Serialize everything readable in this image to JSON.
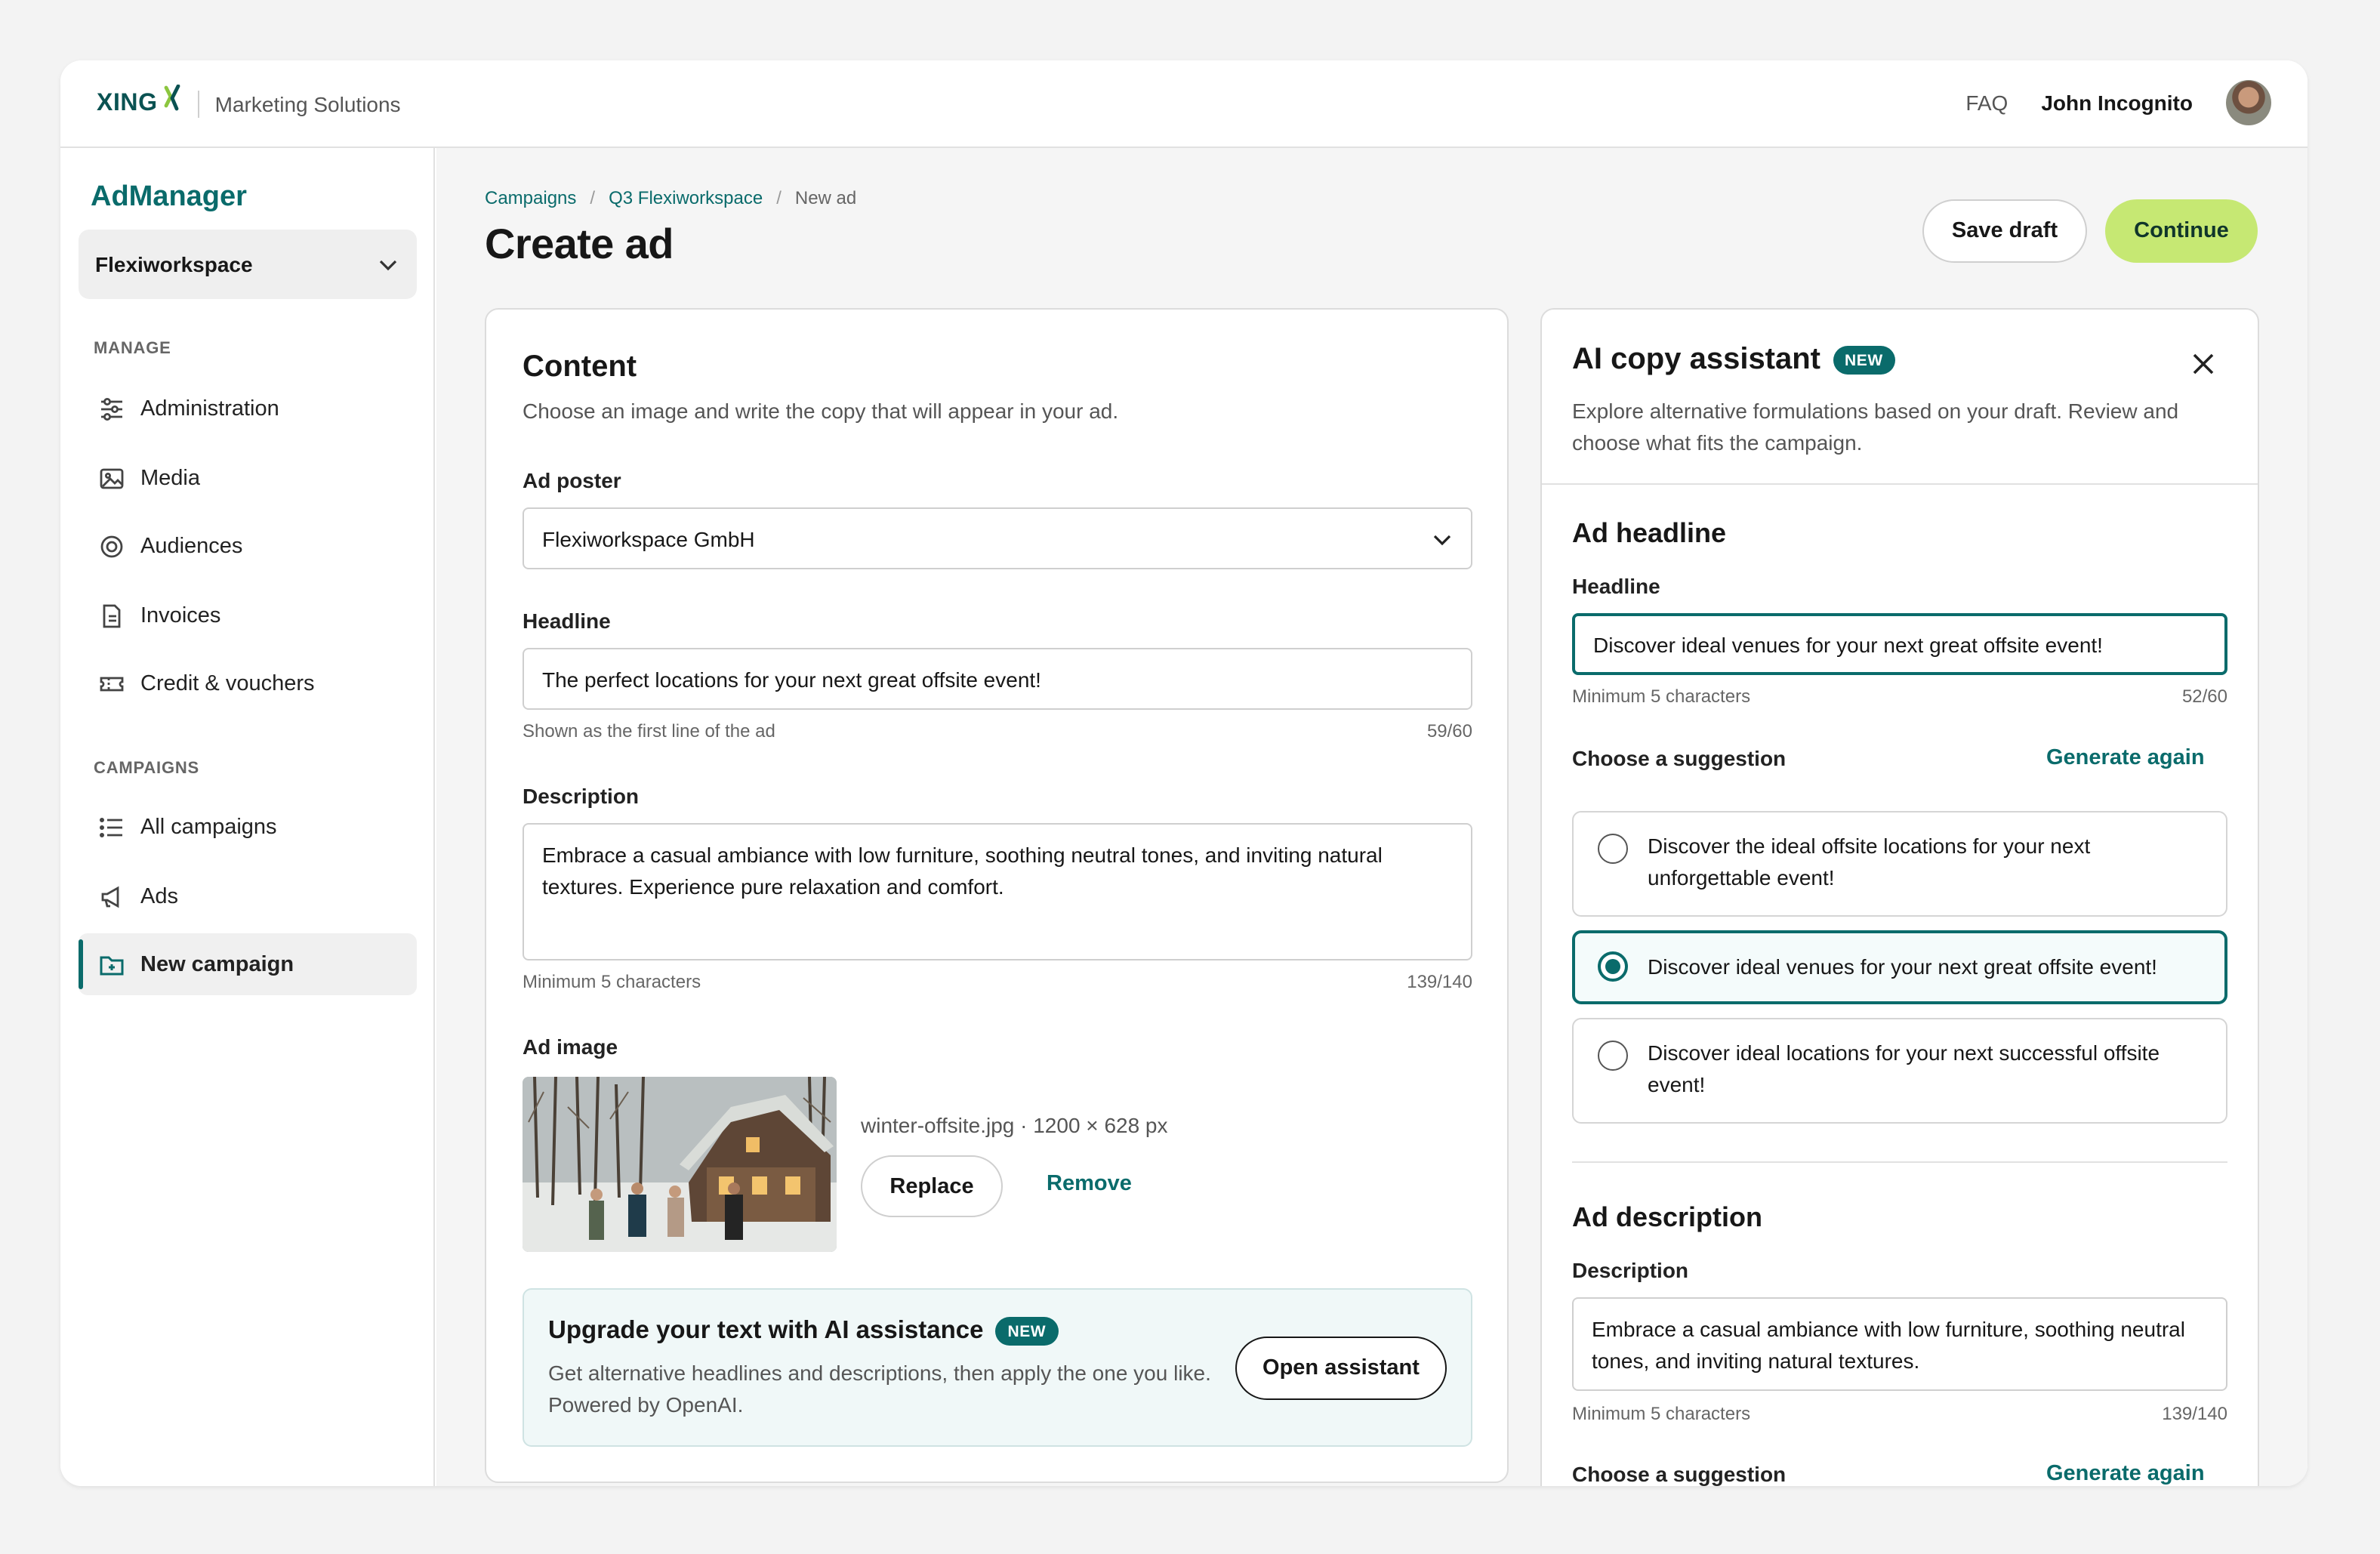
{
  "header": {
    "logo_text": "XING",
    "brand_subtitle": "Marketing Solutions",
    "faq_label": "FAQ",
    "user_name": "John Incognito"
  },
  "sidebar": {
    "app_title": "AdManager",
    "workspace": "Flexiworkspace",
    "manage_label": "MANAGE",
    "manage_items": [
      {
        "label": "Administration",
        "icon": "sliders-icon"
      },
      {
        "label": "Media",
        "icon": "image-icon"
      },
      {
        "label": "Audiences",
        "icon": "target-icon"
      },
      {
        "label": "Invoices",
        "icon": "document-icon"
      },
      {
        "label": "Credit & vouchers",
        "icon": "ticket-icon"
      }
    ],
    "campaigns_label": "CAMPAIGNS",
    "campaign_items": [
      {
        "label": "All campaigns",
        "icon": "list-icon"
      },
      {
        "label": "Ads",
        "icon": "megaphone-icon"
      },
      {
        "label": "New campaign",
        "icon": "folder-plus-icon",
        "active": true
      }
    ]
  },
  "breadcrumb": [
    "Campaigns",
    "Q3 Flexiworkspace",
    "New ad"
  ],
  "page": {
    "title": "Create ad",
    "save_draft": "Save draft",
    "continue": "Continue"
  },
  "content": {
    "title": "Content",
    "subtitle": "Choose an image and write the copy that will appear in your ad.",
    "poster_label": "Ad poster",
    "poster_value": "Flexiworkspace GmbH",
    "headline_label": "Headline",
    "headline_value": "The perfect locations for your next great offsite event!",
    "headline_hint": "Shown as the first line of the ad",
    "headline_count": "59/60",
    "description_label": "Description",
    "description_value": "Embrace a casual ambiance with low furniture, soothing neutral tones, and inviting natural textures. Experience pure relaxation and comfort.",
    "description_hint": "Minimum 5 characters",
    "description_count": "139/140",
    "image_label": "Ad image",
    "image_file": "winter-offsite.jpg · 1200 × 628 px",
    "replace": "Replace",
    "remove": "Remove",
    "promo_title": "Upgrade your text with AI assistance",
    "promo_badge": "NEW",
    "promo_text": "Get alternative headlines and descriptions, then apply the one you like. Powered by OpenAI.",
    "promo_button": "Open assistant"
  },
  "assistant": {
    "title": "AI copy assistant",
    "badge": "NEW",
    "subtitle": "Explore alternative formulations based on your draft. Review and choose what fits the campaign.",
    "headline_section": "Ad headline",
    "headline_label": "Headline",
    "headline_value": "Discover ideal venues for your next great offsite event!",
    "headline_hint": "Minimum 5 characters",
    "headline_count": "52/60",
    "choose_label": "Choose a suggestion",
    "generate_again": "Generate again",
    "suggestions": [
      {
        "text": "Discover the ideal offsite locations for your next unforgettable event!",
        "selected": false
      },
      {
        "text": "Discover ideal venues for your next great offsite event!",
        "selected": true
      },
      {
        "text": "Discover ideal locations for your next successful offsite event!",
        "selected": false
      }
    ],
    "description_section": "Ad description",
    "description_label": "Description",
    "description_value": "Embrace a casual ambiance with low furniture, soothing neutral tones, and inviting natural textures.",
    "description_hint": "Minimum 5 characters",
    "description_count": "139/140",
    "choose_label_2": "Choose a suggestion",
    "generate_again_2": "Generate again"
  },
  "colors": {
    "brand_teal": "#0a6b6b",
    "accent_lime": "#c6e873",
    "logo_green": "#8cc63f"
  }
}
